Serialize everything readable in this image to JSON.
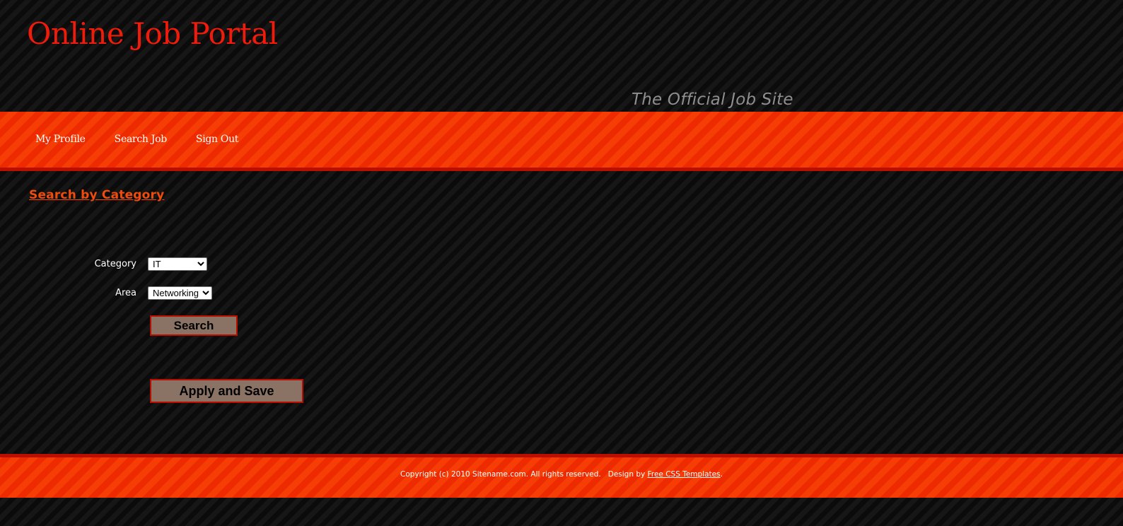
{
  "header": {
    "site_title": "Online Job Portal",
    "tagline": "The Official Job Site"
  },
  "menu": {
    "items": [
      {
        "label": "My Profile"
      },
      {
        "label": "Search Job"
      },
      {
        "label": "Sign Out"
      }
    ]
  },
  "content": {
    "section_title": "Search by Category",
    "form": {
      "category_label": "Category",
      "category_value": "IT",
      "area_label": "Area",
      "area_value": "Networking",
      "search_button": "Search",
      "apply_save_button": "Apply and Save"
    }
  },
  "footer": {
    "copyright": "Copyright (c) 2010 Sitename.com. All rights reserved.",
    "design_by": "Design by",
    "design_link": "Free CSS Templates",
    "end_punct": "."
  },
  "colors": {
    "title": "#f01b0a",
    "accent_bar": "#f03000",
    "accent_border": "#b80f00",
    "section_title": "#f04b0a",
    "tagline": "#8f8f8f",
    "button_bg": "#8a7265"
  }
}
